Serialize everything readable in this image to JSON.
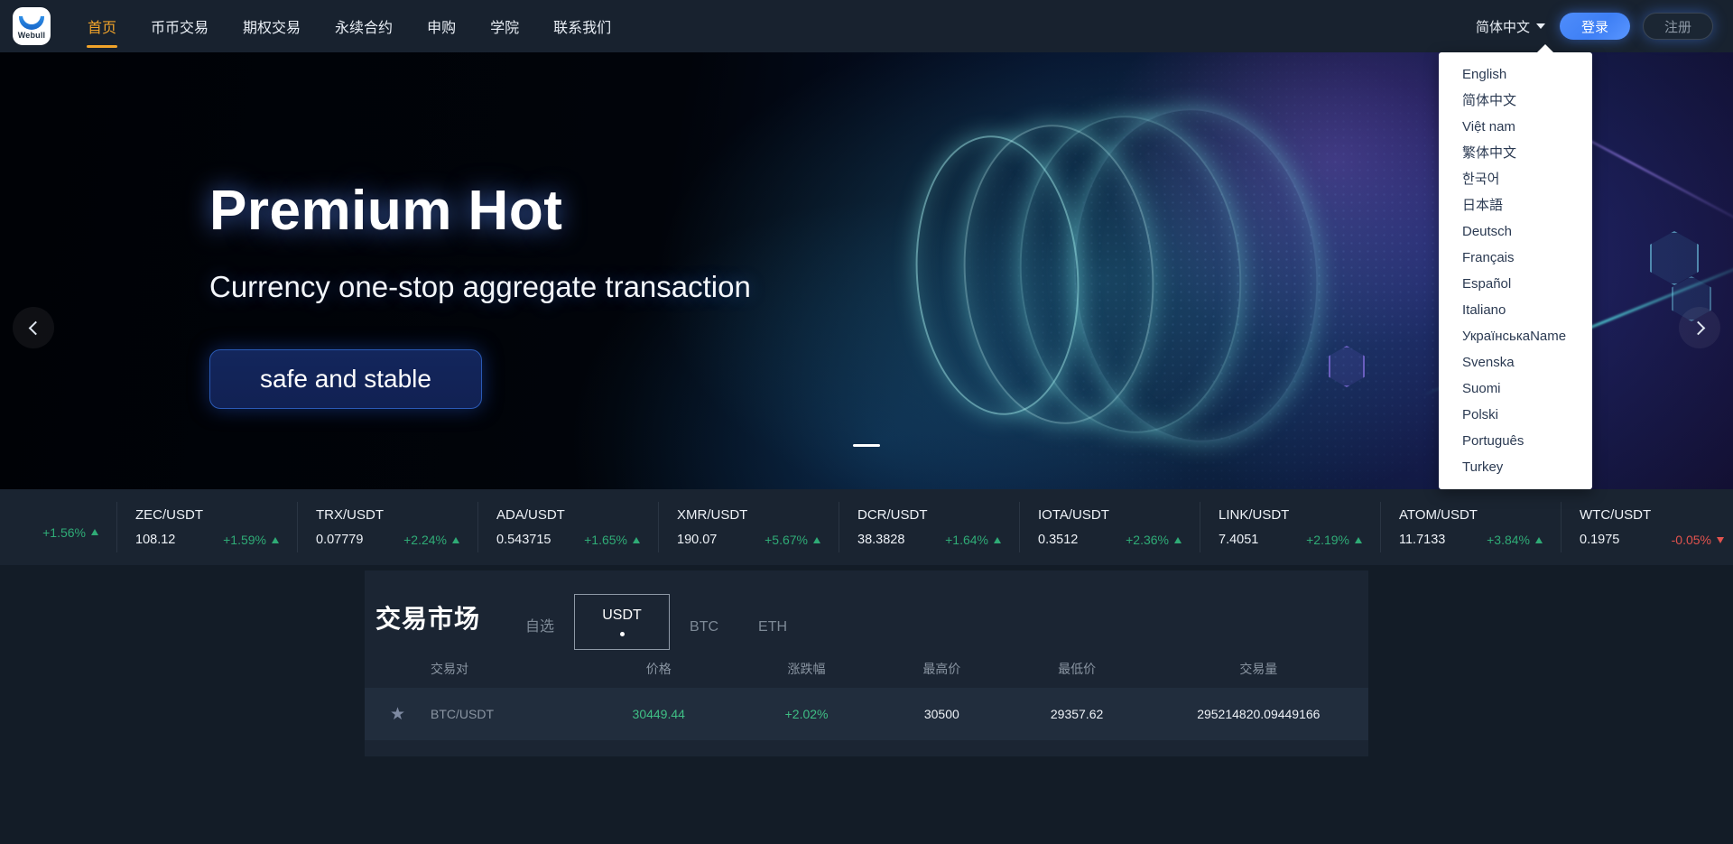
{
  "brand": {
    "name": "Webull",
    "logo_icon": "webull-moon-logo"
  },
  "nav": {
    "items": [
      {
        "label": "首页",
        "active": true
      },
      {
        "label": "币币交易",
        "active": false
      },
      {
        "label": "期权交易",
        "active": false
      },
      {
        "label": "永续合约",
        "active": false
      },
      {
        "label": "申购",
        "active": false
      },
      {
        "label": "学院",
        "active": false
      },
      {
        "label": "联系我们",
        "active": false
      }
    ],
    "language_selected": "简体中文",
    "login_label": "登录",
    "register_label": "注册"
  },
  "language_menu": {
    "open": true,
    "options": [
      "English",
      "简体中文",
      "Việt nam",
      "繁体中文",
      "한국어",
      "日本語",
      "Deutsch",
      "Français",
      "Español",
      "Italiano",
      "УкраїнськаName",
      "Svenska",
      "Suomi",
      "Polski",
      "Português",
      "Turkey"
    ]
  },
  "hero": {
    "title": "Premium Hot",
    "subtitle": "Currency one-stop aggregate transaction",
    "button_label": "safe and stable",
    "prev_icon": "chevron-left-icon",
    "next_icon": "chevron-right-icon",
    "slide_count": 1,
    "active_slide": 0
  },
  "ticker": {
    "items": [
      {
        "symbol": "",
        "price": "",
        "change": "+1.56%",
        "direction": "up",
        "clipped": true
      },
      {
        "symbol": "ZEC/USDT",
        "price": "108.12",
        "change": "+1.59%",
        "direction": "up"
      },
      {
        "symbol": "TRX/USDT",
        "price": "0.07779",
        "change": "+2.24%",
        "direction": "up"
      },
      {
        "symbol": "ADA/USDT",
        "price": "0.543715",
        "change": "+1.65%",
        "direction": "up"
      },
      {
        "symbol": "XMR/USDT",
        "price": "190.07",
        "change": "+5.67%",
        "direction": "up"
      },
      {
        "symbol": "DCR/USDT",
        "price": "38.3828",
        "change": "+1.64%",
        "direction": "up"
      },
      {
        "symbol": "IOTA/USDT",
        "price": "0.3512",
        "change": "+2.36%",
        "direction": "up"
      },
      {
        "symbol": "LINK/USDT",
        "price": "7.4051",
        "change": "+2.19%",
        "direction": "up"
      },
      {
        "symbol": "ATOM/USDT",
        "price": "11.7133",
        "change": "+3.84%",
        "direction": "up"
      },
      {
        "symbol": "WTC/USDT",
        "price": "0.1975",
        "change": "-0.05%",
        "direction": "down"
      }
    ]
  },
  "market": {
    "title": "交易市场",
    "tabs": [
      {
        "label": "自选",
        "selected": false
      },
      {
        "label": "USDT",
        "selected": true
      },
      {
        "label": "BTC",
        "selected": false
      },
      {
        "label": "ETH",
        "selected": false
      }
    ],
    "columns": {
      "pair": "交易对",
      "price": "价格",
      "change": "涨跌幅",
      "high": "最高价",
      "low": "最低价",
      "volume": "交易量"
    },
    "rows": [
      {
        "favorite": true,
        "favorite_icon": "star-icon",
        "pair": "BTC/USDT",
        "price": "30449.44",
        "change": "+2.02%",
        "high": "30500",
        "low": "29357.62",
        "volume": "295214820.09449166"
      }
    ]
  },
  "colors": {
    "page_bg": "#131c27",
    "nav_bg": "#18222f",
    "accent_orange": "#f0a32a",
    "accent_blue": "#4f8dfb",
    "up_green": "#2fab76",
    "down_red": "#e3534e",
    "card_bg": "#1b2533",
    "row_bg": "#212d3d"
  }
}
